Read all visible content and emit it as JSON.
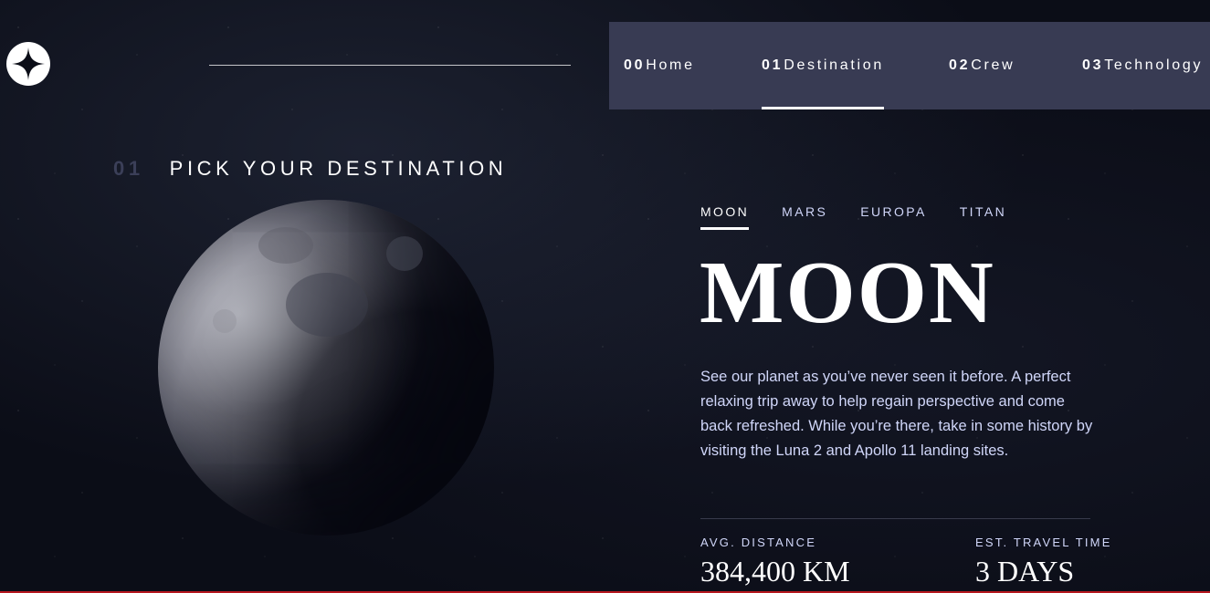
{
  "nav": {
    "items": [
      {
        "num": "00",
        "label": "Home"
      },
      {
        "num": "01",
        "label": "Destination"
      },
      {
        "num": "02",
        "label": "Crew"
      },
      {
        "num": "03",
        "label": "Technology"
      }
    ],
    "active_index": 1
  },
  "page": {
    "heading_num": "01",
    "heading_text": "PICK YOUR DESTINATION"
  },
  "destination": {
    "tabs": [
      "MOON",
      "MARS",
      "EUROPA",
      "TITAN"
    ],
    "active_tab": 0,
    "title": "MOON",
    "description": "See our planet as you’ve never seen it before. A perfect relaxing trip away to help regain perspective and come back refreshed. While you’re there, take in some history by visiting the Luna 2 and Apollo 11 landing sites.",
    "stats": {
      "distance_label": "AVG. DISTANCE",
      "distance_value": "384,400 KM",
      "travel_label": "EST. TRAVEL TIME",
      "travel_value": "3 DAYS"
    }
  },
  "icons": {
    "logo": "star-logo-icon",
    "destination_image": "moon-image"
  },
  "colors": {
    "background": "#0b0d17",
    "nav_background": "#383b53",
    "text_light": "#d0d6f9",
    "accent_white": "#ffffff"
  }
}
